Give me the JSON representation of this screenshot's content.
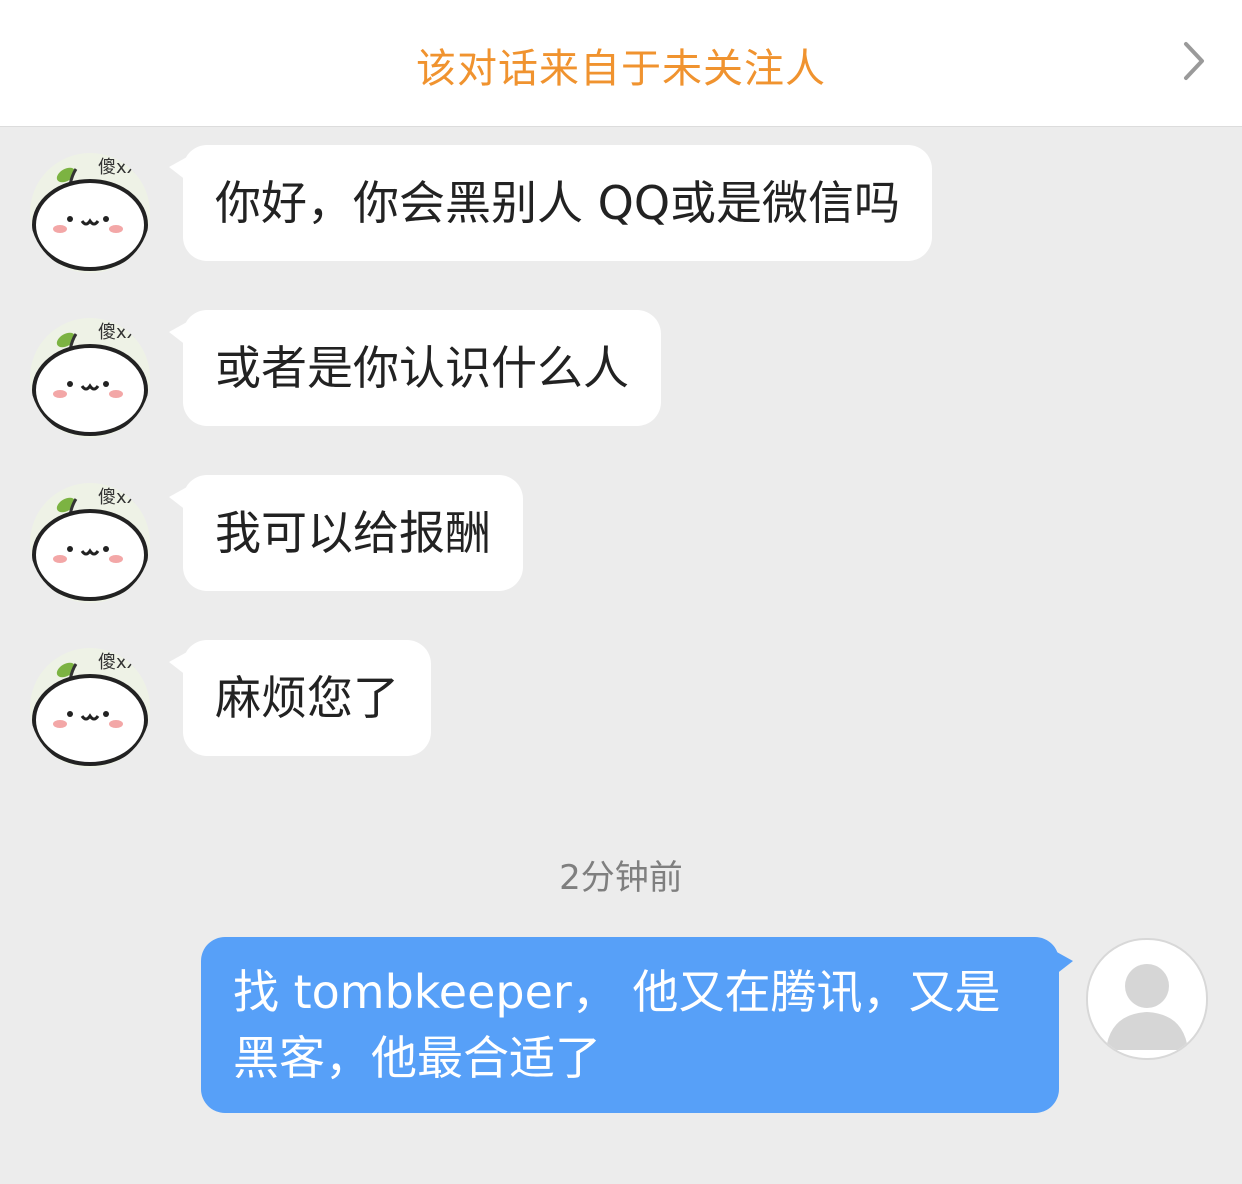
{
  "banner": {
    "text": "该对话来自于未关注人",
    "icon": "chevron-right-icon",
    "color": "#f0932f"
  },
  "messages_incoming": [
    {
      "text": "你好，你会黑别人 QQ或是微信吗",
      "avatar_label": "傻xx"
    },
    {
      "text": "或者是你认识什么人",
      "avatar_label": "傻xx"
    },
    {
      "text": "我可以给报酬",
      "avatar_label": "傻xx"
    },
    {
      "text": "麻烦您了",
      "avatar_label": "傻xx"
    }
  ],
  "timestamp": "2分钟前",
  "message_outgoing": {
    "text": "找 tombkeeper， 他又在腾讯，又是黑客，他最合适了",
    "color": "#57a0f8",
    "avatar_icon": "default-user-icon"
  }
}
